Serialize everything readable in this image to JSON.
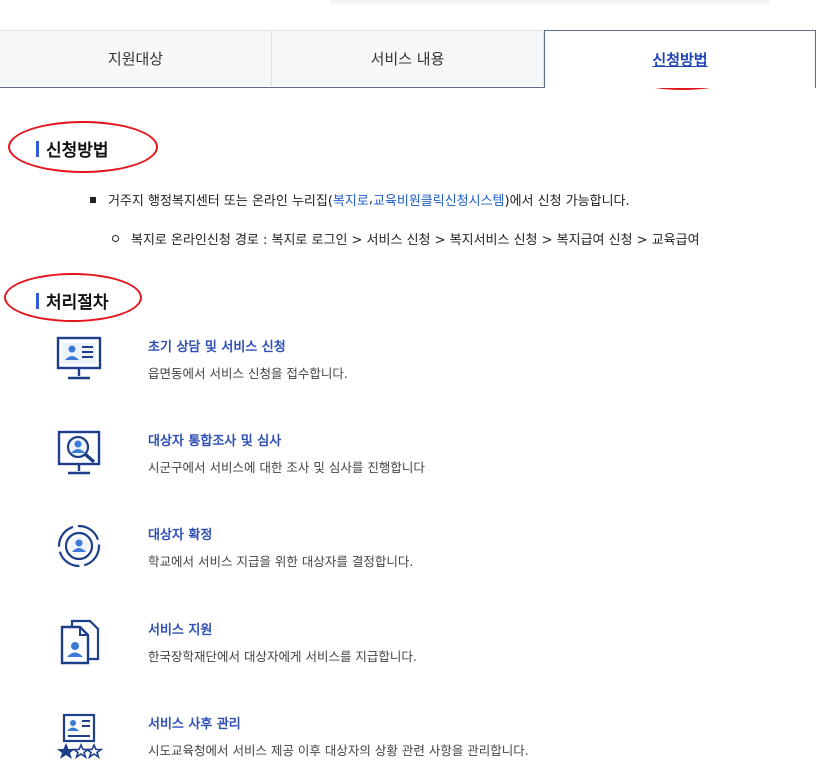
{
  "tabs": [
    {
      "label": "지원대상"
    },
    {
      "label": "서비스 내용"
    },
    {
      "label": "신청방법",
      "active": true
    }
  ],
  "apply": {
    "title": "신청방법",
    "bullet_pre": "거주지 행정복지센터 또는 온라인 누리집(",
    "link1": "복지로",
    "sep": ", ",
    "link2": "교육비원클릭신청시스템",
    "bullet_post": ")에서 신청 가능합니다.",
    "sub_bullet": "복지로 온라인신청 경로 : 복지로 로그인 > 서비스 신청 > 복지서비스 신청 > 복지급여 신청 > 교육급여"
  },
  "process": {
    "title": "처리절차",
    "steps": [
      {
        "icon": "monitor-profile-icon",
        "title": "초기 상담 및 서비스 신청",
        "desc": "읍면동에서 서비스 신청을 접수합니다."
      },
      {
        "icon": "monitor-search-user-icon",
        "title": "대상자 통합조사 및 심사",
        "desc": "시군구에서 서비스에 대한 조사 및 심사를 진행합니다"
      },
      {
        "icon": "target-user-icon",
        "title": "대상자 확정",
        "desc": "학교에서 서비스 지급을 위한 대상자를 결정합니다."
      },
      {
        "icon": "user-document-icon",
        "title": "서비스 지원",
        "desc": "한국장학재단에서 대상자에게 서비스를 지급합니다."
      },
      {
        "icon": "profile-rating-icon",
        "title": "서비스 사후 관리",
        "desc": "시도교육청에서 서비스 제공 이후 대상자의 상황 관련 사항을 관리합니다."
      }
    ]
  },
  "colors": {
    "accent": "#2f5ad6",
    "link": "#1f5ec9",
    "highlight_circle": "#e4141b",
    "icon": "#1d3f8a"
  }
}
